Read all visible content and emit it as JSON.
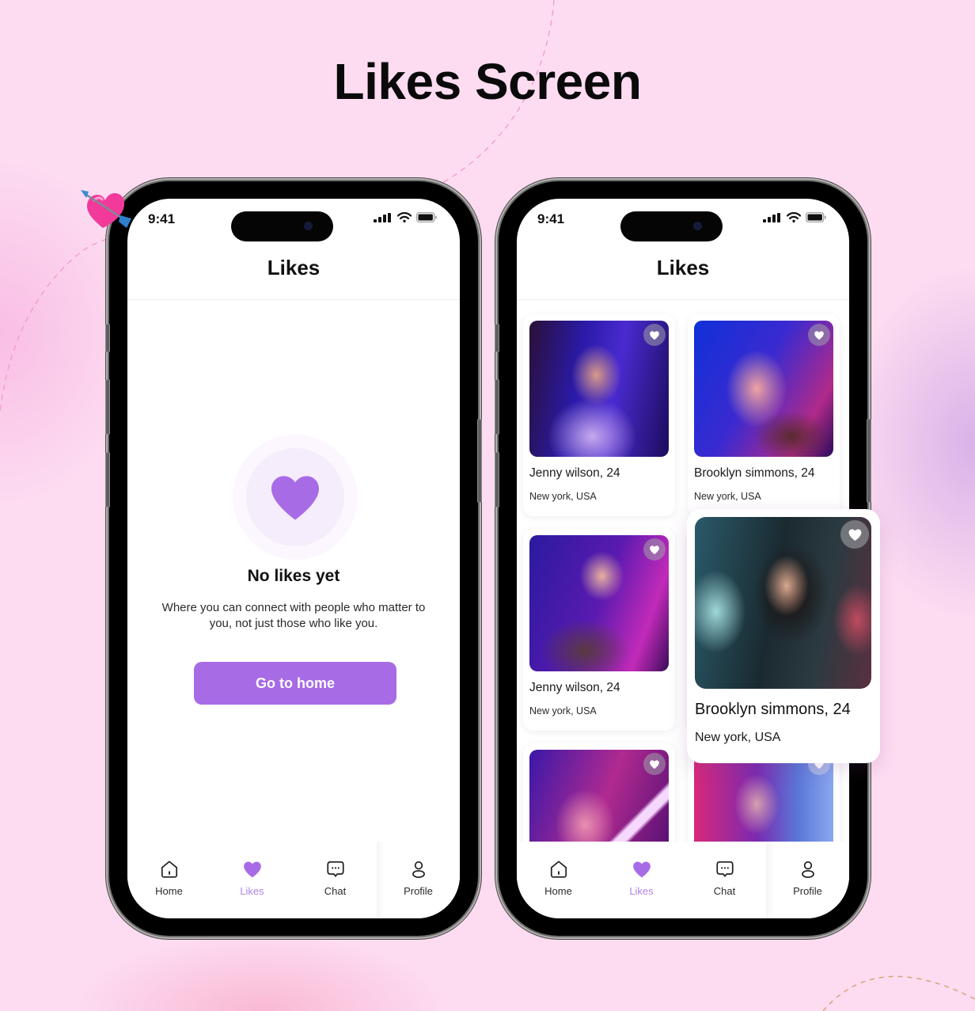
{
  "page": {
    "title": "Likes Screen"
  },
  "colors": {
    "accent": "#a86be6",
    "accent_light": "#b184e8",
    "background": "#fddcf1"
  },
  "phones": [
    {
      "status_bar": {
        "time": "9:41",
        "icons": [
          "signal-icon",
          "wifi-icon",
          "battery-icon"
        ]
      },
      "header": {
        "title": "Likes"
      },
      "empty_state": {
        "icon": "heart-icon",
        "title": "No likes yet",
        "description": "Where you can connect with people who matter to you, not just those who like you.",
        "button_label": "Go to home"
      },
      "tab_bar": [
        {
          "label": "Home",
          "icon": "home-icon",
          "active": false
        },
        {
          "label": "Likes",
          "icon": "heart-icon",
          "active": true
        },
        {
          "label": "Chat",
          "icon": "chat-icon",
          "active": false
        },
        {
          "label": "Profile",
          "icon": "profile-icon",
          "active": false
        }
      ]
    },
    {
      "status_bar": {
        "time": "9:41",
        "icons": [
          "signal-icon",
          "wifi-icon",
          "battery-icon"
        ]
      },
      "header": {
        "title": "Likes"
      },
      "cards": [
        {
          "name": "Jenny wilson, 24",
          "location": "New york, USA",
          "liked": true
        },
        {
          "name": "Brooklyn simmons, 24",
          "location": "New york, USA",
          "liked": true
        },
        {
          "name": "Jenny wilson, 24",
          "location": "New york, USA",
          "liked": true
        },
        {
          "name": "Brooklyn simmons, 24",
          "location": "New york, USA",
          "liked": true
        },
        {
          "name": "",
          "location": "",
          "liked": true
        },
        {
          "name": "",
          "location": "",
          "liked": true
        }
      ],
      "featured_card": {
        "name": "Brooklyn simmons, 24",
        "location": "New york, USA",
        "liked": true
      },
      "tab_bar": [
        {
          "label": "Home",
          "icon": "home-icon",
          "active": false
        },
        {
          "label": "Likes",
          "icon": "heart-icon",
          "active": true
        },
        {
          "label": "Chat",
          "icon": "chat-icon",
          "active": false
        },
        {
          "label": "Profile",
          "icon": "profile-icon",
          "active": false
        }
      ]
    }
  ]
}
